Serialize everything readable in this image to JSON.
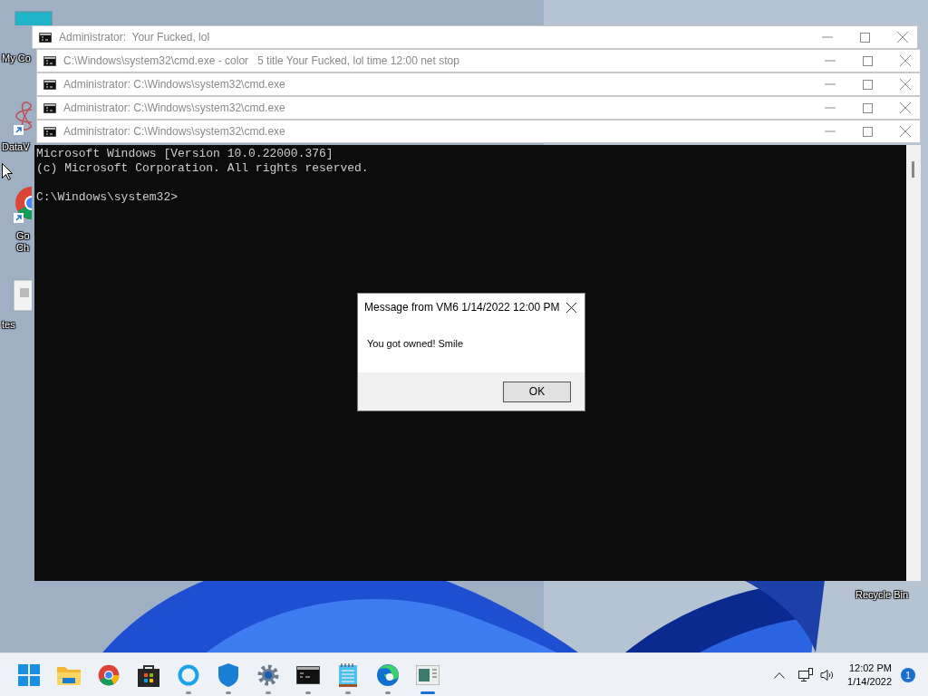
{
  "desktop_icons": [
    {
      "kind": "monitor",
      "label": "My Co",
      "shortcut": false
    },
    {
      "kind": "atom",
      "label": "DataV",
      "shortcut": true
    },
    {
      "kind": "chrome",
      "label": "Go Ch",
      "shortcut": true
    },
    {
      "kind": "file",
      "label": "tes",
      "shortcut": false
    }
  ],
  "recycle_bin": {
    "label": "Recycle Bin"
  },
  "windows": [
    {
      "title": "Administrator:  Your Fucked, lol"
    },
    {
      "title": "C:\\Windows\\system32\\cmd.exe - color   5 title Your Fucked, lol time 12:00 net stop"
    },
    {
      "title": "Administrator: C:\\Windows\\system32\\cmd.exe"
    },
    {
      "title": "Administrator: C:\\Windows\\system32\\cmd.exe"
    },
    {
      "title": "Administrator: C:\\Windows\\system32\\cmd.exe"
    }
  ],
  "console": {
    "output_lines": [
      "Microsoft Windows [Version 10.0.22000.376]",
      "(c) Microsoft Corporation. All rights reserved."
    ],
    "prompt": "C:\\Windows\\system32>"
  },
  "dialog": {
    "title": "Message from VM6 1/14/2022 12:00 PM",
    "message": "You got owned! Smile",
    "button": "OK"
  },
  "taskbar": {
    "apps": [
      {
        "kind": "start",
        "running": false,
        "active": false
      },
      {
        "kind": "folder",
        "running": false,
        "active": false
      },
      {
        "kind": "chrome",
        "running": false,
        "active": false
      },
      {
        "kind": "store",
        "running": false,
        "active": false
      },
      {
        "kind": "cortana",
        "running": true,
        "active": false
      },
      {
        "kind": "shield",
        "running": true,
        "active": false
      },
      {
        "kind": "gear",
        "running": true,
        "active": false
      },
      {
        "kind": "terminal",
        "running": true,
        "active": false
      },
      {
        "kind": "notepad",
        "running": true,
        "active": false
      },
      {
        "kind": "edge",
        "running": true,
        "active": false
      },
      {
        "kind": "app",
        "running": true,
        "active": true
      }
    ],
    "tray": {
      "time": "12:02 PM",
      "date": "1/14/2022",
      "notifications": "1"
    }
  }
}
